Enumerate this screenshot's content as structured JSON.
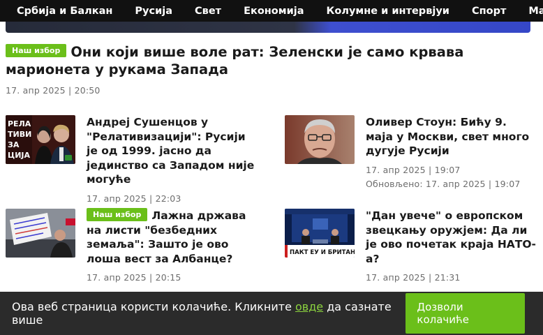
{
  "nav": {
    "items": [
      "Србија и Балкан",
      "Русија",
      "Свет",
      "Економија",
      "Колумне и интервјуи",
      "Спорт",
      "Магази"
    ]
  },
  "lead": {
    "badge": "Наш избор",
    "title": "Они који више воле рат: Зеленски је само крвава марионета у рукама Запада",
    "date": "17. апр 2025 | 20:50"
  },
  "articles": [
    {
      "title": "Андреј Сушенцов у \"Релативизацији\": Русији је од 1999. јасно да јединство са Западом није могуће",
      "date": "17. апр 2025 | 22:03",
      "thumb_text": [
        "РЕЛА",
        "ТИВИ",
        "ЗА",
        "ЦИЈА"
      ]
    },
    {
      "title": "Оливер Стоун: Бићу 9. маја у Москви, свет много дугује Русији",
      "date": "17. апр 2025 | 19:07",
      "updated": "Обновљено: 17. апр 2025 | 19:07"
    },
    {
      "badge": "Наш избор",
      "title": "Лажна држава на листи \"безбедних земаља\": Зашто је ово лоша вест за Албанце?",
      "date": "17. апр 2025 | 20:15"
    },
    {
      "title": "\"Дан увече\" о европском звецкању оружјем: Да ли је ово почетак краја НАТО-а?",
      "date": "17. апр 2025 | 21:31",
      "thumb_text": "ПАКТ ЕУ И БРИТАНИЈЕ"
    }
  ],
  "cookie": {
    "text_before": "Ова веб страница користи колачиће. Кликните ",
    "link": "овде",
    "text_after": " да сазнате више",
    "button": "Дозволи колачиће"
  },
  "colors": {
    "accent": "#6bbf1a",
    "nav_bg": "#111111",
    "cookie_bg": "#2b2b2b"
  }
}
